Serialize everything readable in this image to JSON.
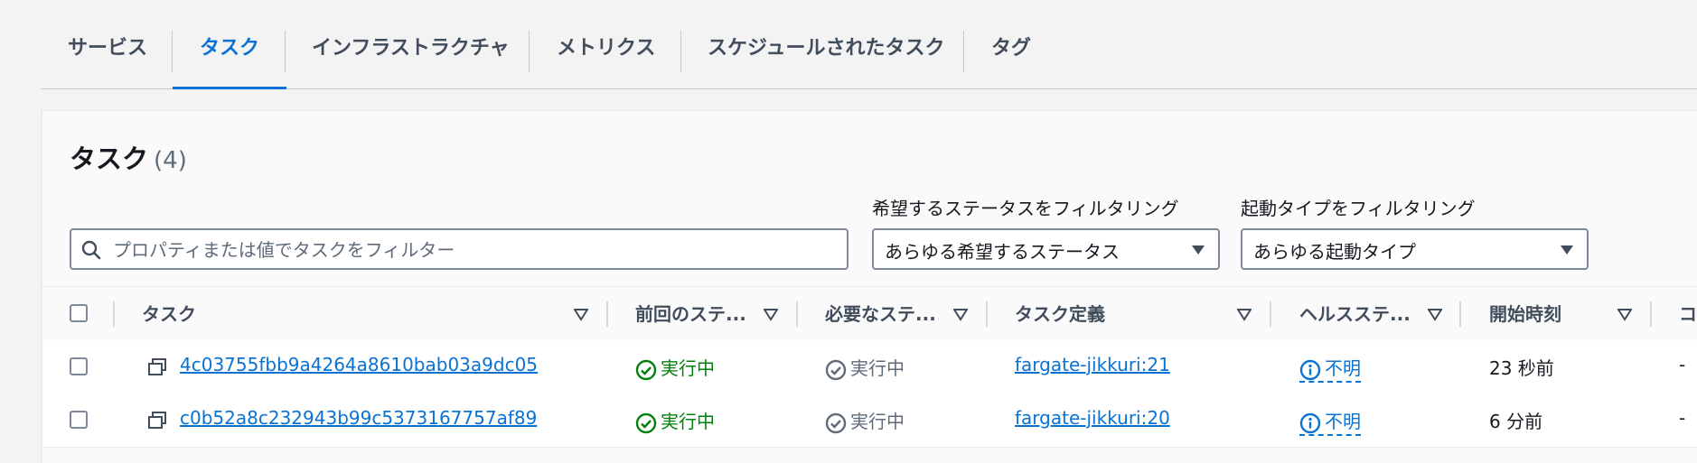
{
  "tabs": [
    {
      "label": "サービス",
      "active": false
    },
    {
      "label": "タスク",
      "active": true
    },
    {
      "label": "インフラストラクチャ",
      "active": false
    },
    {
      "label": "メトリクス",
      "active": false
    },
    {
      "label": "スケジュールされたタスク",
      "active": false
    },
    {
      "label": "タグ",
      "active": false
    }
  ],
  "panel": {
    "title": "タスク",
    "count": "(4)"
  },
  "search": {
    "placeholder": "プロパティまたは値でタスクをフィルター",
    "value": ""
  },
  "filters": [
    {
      "label": "希望するステータスをフィルタリング",
      "value": "あらゆる希望するステータス"
    },
    {
      "label": "起動タイプをフィルタリング",
      "value": "あらゆる起動タイプ"
    }
  ],
  "table": {
    "columns": [
      "タスク",
      "前回のステ...",
      "必要なステ...",
      "タスク定義",
      "ヘルスステ...",
      "開始時刻",
      "コ"
    ],
    "rows": [
      {
        "task": "4c03755fbb9a4264a8610bab03a9dc05",
        "last_status": "実行中",
        "desired_status": "実行中",
        "task_definition": "fargate-jikkuri:21",
        "health": "不明",
        "started": "23 秒前",
        "extra": "-"
      },
      {
        "task": "c0b52a8c232943b99c5373167757af89",
        "last_status": "実行中",
        "desired_status": "実行中",
        "task_definition": "fargate-jikkuri:20",
        "health": "不明",
        "started": "6 分前",
        "extra": "-"
      }
    ]
  },
  "colors": {
    "accent": "#0972d3",
    "success": "#037f0c",
    "muted": "#5f6b7a"
  }
}
